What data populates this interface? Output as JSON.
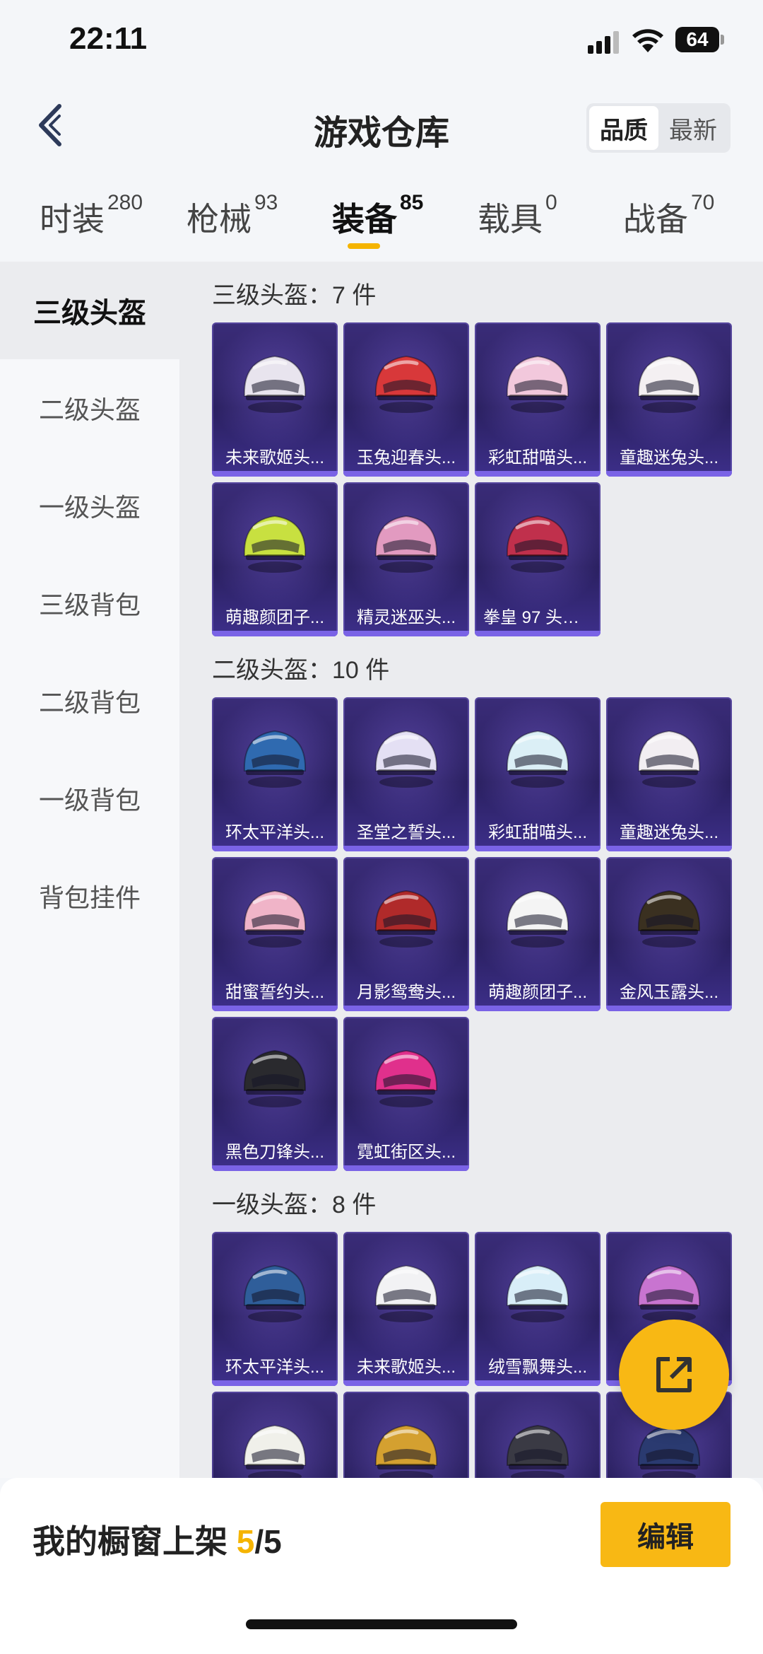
{
  "status": {
    "time": "22:11",
    "battery": "64"
  },
  "header": {
    "title": "游戏仓库",
    "sort": [
      "品质",
      "最新"
    ]
  },
  "tabs": [
    {
      "label": "时装",
      "count": "280"
    },
    {
      "label": "枪械",
      "count": "93"
    },
    {
      "label": "装备",
      "count": "85"
    },
    {
      "label": "载具",
      "count": "0"
    },
    {
      "label": "战备",
      "count": "70"
    }
  ],
  "sidebar": [
    "三级头盔",
    "二级头盔",
    "一级头盔",
    "三级背包",
    "二级背包",
    "一级背包",
    "背包挂件"
  ],
  "groups": [
    {
      "title": "三级头盔：7 件",
      "items": [
        {
          "name": "未来歌姬头...",
          "color": "#e8e4ee"
        },
        {
          "name": "玉兔迎春头...",
          "color": "#d8383a"
        },
        {
          "name": "彩虹甜喵头...",
          "color": "#f2c8dc"
        },
        {
          "name": "童趣迷兔头...",
          "color": "#f4f0f2"
        },
        {
          "name": "萌趣颜团子...",
          "color": "#c8e040"
        },
        {
          "name": "精灵迷巫头...",
          "color": "#e29ac0"
        },
        {
          "name": "拳皇 97 头盔...",
          "color": "#c0304c"
        }
      ]
    },
    {
      "title": "二级头盔：10 件",
      "items": [
        {
          "name": "环太平洋头...",
          "color": "#2f6ab0"
        },
        {
          "name": "圣堂之誓头...",
          "color": "#e4e0f4"
        },
        {
          "name": "彩虹甜喵头...",
          "color": "#dbeff6"
        },
        {
          "name": "童趣迷兔头...",
          "color": "#f2eef2"
        },
        {
          "name": "甜蜜誓约头...",
          "color": "#f0b4c8"
        },
        {
          "name": "月影鸳鸯头...",
          "color": "#b02a2a"
        },
        {
          "name": "萌趣颜团子...",
          "color": "#f4f4f4"
        },
        {
          "name": "金风玉露头...",
          "color": "#3a3020"
        },
        {
          "name": "黑色刀锋头...",
          "color": "#2a2a2e"
        },
        {
          "name": "霓虹街区头...",
          "color": "#e0308c"
        }
      ]
    },
    {
      "title": "一级头盔：8 件",
      "items": [
        {
          "name": "环太平洋头...",
          "color": "#2f5e9a"
        },
        {
          "name": "未来歌姬头...",
          "color": "#f2f2f4"
        },
        {
          "name": "绒雪飘舞头...",
          "color": "#d8eef8"
        },
        {
          "name": "",
          "color": "#c874d0"
        },
        {
          "name": "",
          "color": "#f0f0ea"
        },
        {
          "name": "",
          "color": "#d4a030"
        },
        {
          "name": "",
          "color": "#3a3a44"
        },
        {
          "name": "",
          "color": "#2a3a70"
        }
      ]
    }
  ],
  "bottom": {
    "shelf_label": "我的橱窗上架 ",
    "shelf_count": "5",
    "shelf_total": "/5",
    "edit_label": "编辑"
  }
}
